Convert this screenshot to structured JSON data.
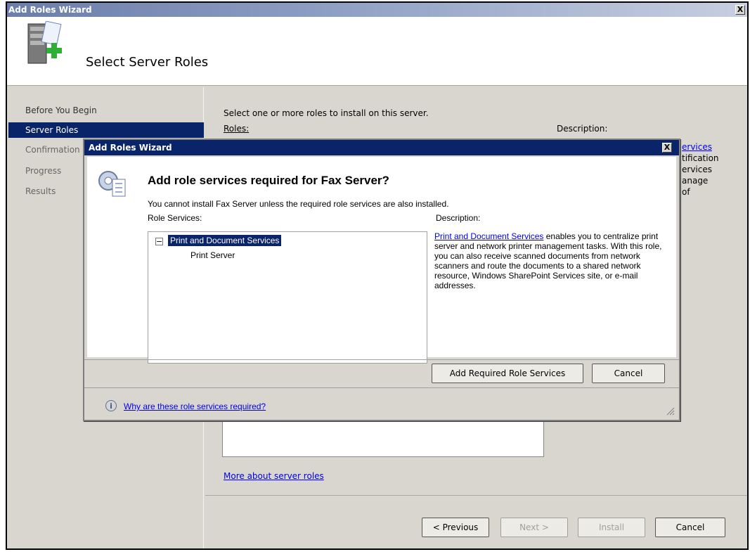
{
  "outer": {
    "title": "Add Roles Wizard",
    "close_label": "X",
    "page_title": "Select Server Roles"
  },
  "nav": {
    "items": [
      {
        "label": "Before You Begin"
      },
      {
        "label": "Server Roles"
      },
      {
        "label": "Confirmation"
      },
      {
        "label": "Progress"
      },
      {
        "label": "Results"
      }
    ]
  },
  "main": {
    "instruction": "Select one or more roles to install on this server.",
    "roles_label": "Roles:",
    "description_label": "Description:",
    "partial_desc": [
      "ervices",
      "tification",
      "ervices",
      "anage",
      "of"
    ],
    "more_link": "More about server roles"
  },
  "footer": {
    "previous": "< Previous",
    "next": "Next >",
    "install": "Install",
    "cancel": "Cancel"
  },
  "dialog": {
    "title": "Add Roles Wizard",
    "close_label": "X",
    "heading": "Add role services required for Fax Server?",
    "subtext": "You cannot install Fax Server unless the required role services are also installed.",
    "role_services_label": "Role Services:",
    "description_label": "Description:",
    "tree": {
      "expander": "−",
      "parent": "Print and Document Services",
      "child": "Print Server"
    },
    "description_link": "Print and Document Services",
    "description_text": " enables you to centralize print server and network printer management tasks. With this role, you can also receive scanned documents from network scanners and route the documents to a shared network resource, Windows SharePoint Services site, or e-mail addresses.",
    "add_button": "Add Required Role Services",
    "cancel_button": "Cancel",
    "help_link": "Why are these role services required?"
  }
}
